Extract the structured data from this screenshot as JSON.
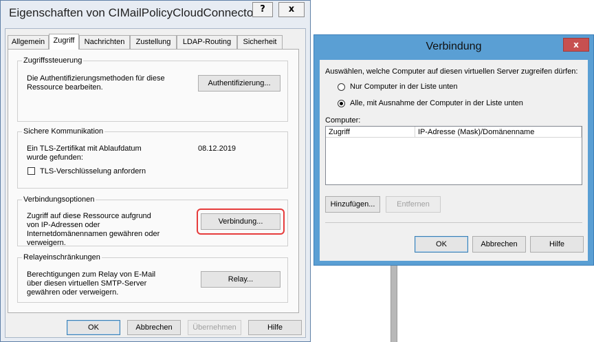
{
  "main_dialog": {
    "title": "Eigenschaften von CIMailPolicyCloudConnector",
    "help_btn": "?",
    "close_btn": "x",
    "tabs": [
      "Allgemein",
      "Zugriff",
      "Nachrichten",
      "Zustellung",
      "LDAP-Routing",
      "Sicherheit"
    ],
    "active_tab": "Zugriff",
    "groups": {
      "access_control": {
        "title": "Zugriffssteuerung",
        "text": "Die Authentifizierungsmethoden für diese Ressource bearbeiten.",
        "button": "Authentifizierung..."
      },
      "secure_comm": {
        "title": "Sichere Kommunikation",
        "text": "Ein TLS-Zertifikat mit Ablaufdatum wurde gefunden:",
        "date": "08.12.2019",
        "checkbox_label": "TLS-Verschlüsselung anfordern"
      },
      "connection_options": {
        "title": "Verbindungsoptionen",
        "text": "Zugriff auf diese Ressource aufgrund von IP-Adressen oder Internetdomänennamen gewähren oder verweigern.",
        "button": "Verbindung..."
      },
      "relay": {
        "title": "Relayeinschränkungen",
        "text": "Berechtigungen zum Relay von E-Mail über diesen virtuellen SMTP-Server gewähren oder verweigern.",
        "button": "Relay..."
      }
    },
    "footer": {
      "ok": "OK",
      "cancel": "Abbrechen",
      "apply": "Übernehmen",
      "help": "Hilfe"
    }
  },
  "connection_dialog": {
    "title": "Verbindung",
    "close_btn": "x",
    "prompt": "Auswählen, welche Computer auf diesen virtuellen Server zugreifen dürfen:",
    "options": [
      {
        "label": "Nur Computer in der Liste unten",
        "selected": false
      },
      {
        "label": "Alle, mit Ausnahme der Computer in der Liste unten",
        "selected": true
      }
    ],
    "list_label": "Computer:",
    "columns": [
      "Zugriff",
      "IP-Adresse (Mask)/Domänenname"
    ],
    "add_button": "Hinzufügen...",
    "remove_button": "Entfernen",
    "ok": "OK",
    "cancel": "Abbrechen",
    "help": "Hilfe"
  },
  "colors": {
    "highlight": "#e63b3b",
    "conn_titlebar": "#5a9fd4",
    "close_red": "#c75050"
  }
}
